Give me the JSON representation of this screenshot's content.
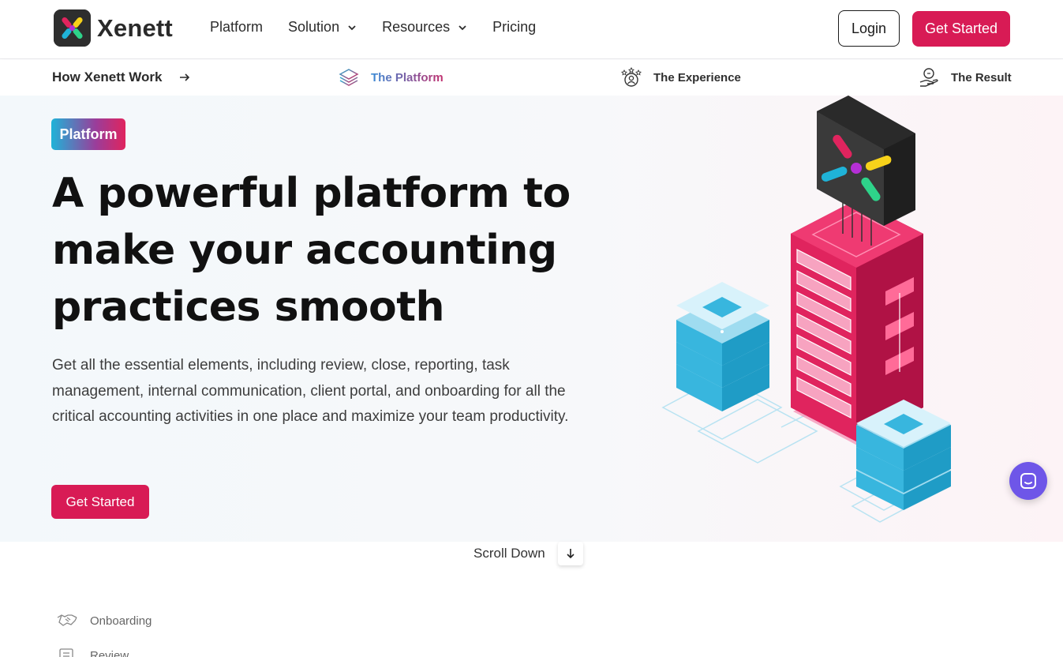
{
  "brand": {
    "name": "Xenett"
  },
  "nav": {
    "links": [
      {
        "label": "Platform",
        "has_dropdown": false
      },
      {
        "label": "Solution",
        "has_dropdown": true
      },
      {
        "label": "Resources",
        "has_dropdown": true
      },
      {
        "label": "Pricing",
        "has_dropdown": false
      }
    ],
    "login_label": "Login",
    "get_started_label": "Get Started"
  },
  "subnav": {
    "title": "How Xenett Work",
    "items": [
      {
        "label": "The Platform",
        "icon": "layers-icon",
        "active": true
      },
      {
        "label": "The Experience",
        "icon": "user-stars-icon",
        "active": false
      },
      {
        "label": "The Result",
        "icon": "hand-coin-icon",
        "active": false
      }
    ]
  },
  "hero": {
    "badge": "Platform",
    "title_lines": [
      "A powerful platform to",
      "make your accounting",
      "practices smooth"
    ],
    "description": "Get all the essential elements, including review, close, reporting, task management, internal communication, client portal, and onboarding for all the critical accounting activities in one place and maximize your team productivity.",
    "cta_label": "Get Started"
  },
  "scroll": {
    "label": "Scroll Down"
  },
  "features": [
    {
      "label": "Onboarding",
      "icon": "handshake-icon"
    },
    {
      "label": "Review",
      "icon": "document-icon"
    }
  ],
  "colors": {
    "accent": "#d81b55",
    "chat": "#6e56e8",
    "server_pink": "#d81b55",
    "server_blue": "#38b6de"
  }
}
